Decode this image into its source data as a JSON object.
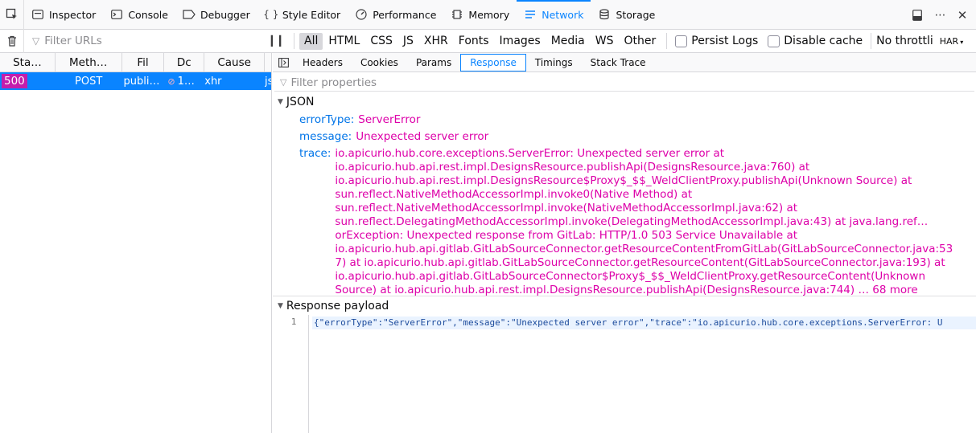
{
  "toolbar": {
    "tabs": [
      {
        "label": "Inspector",
        "icon": "inspector-icon"
      },
      {
        "label": "Console",
        "icon": "console-icon"
      },
      {
        "label": "Debugger",
        "icon": "debugger-icon"
      },
      {
        "label": "Style Editor",
        "icon": "braces-icon"
      },
      {
        "label": "Performance",
        "icon": "performance-icon"
      },
      {
        "label": "Memory",
        "icon": "memory-icon"
      },
      {
        "label": "Network",
        "icon": "network-icon",
        "active": true
      },
      {
        "label": "Storage",
        "icon": "storage-icon"
      }
    ]
  },
  "filterbar": {
    "placeholder": "Filter URLs",
    "types": [
      "All",
      "HTML",
      "CSS",
      "JS",
      "XHR",
      "Fonts",
      "Images",
      "Media",
      "WS",
      "Other"
    ],
    "active_type": "All",
    "persist_logs": "Persist Logs",
    "disable_cache": "Disable cache",
    "throttling": "No throttli",
    "har": "HAR"
  },
  "request_list": {
    "columns": [
      "Sta…",
      "Meth…",
      "Fil",
      "Dc",
      "Cause",
      ""
    ],
    "rows": [
      {
        "status": "500",
        "method": "POST",
        "file": "publi…",
        "domain": "1…",
        "cause": "xhr",
        "type": "js"
      }
    ]
  },
  "details": {
    "tabs": [
      "Headers",
      "Cookies",
      "Params",
      "Response",
      "Timings",
      "Stack Trace"
    ],
    "active_tab": "Response",
    "filter_placeholder": "Filter properties",
    "json_section": "JSON",
    "fields": {
      "errorType_key": "errorType:",
      "errorType_val": "ServerError",
      "message_key": "message:",
      "message_val": "Unexpected server error",
      "trace_key": "trace:"
    },
    "trace_lines": [
      "io.apicurio.hub.core.exceptions.ServerError: Unexpected server error at",
      "io.apicurio.hub.api.rest.impl.DesignsResource.publishApi(DesignsResource.java:760) at",
      "io.apicurio.hub.api.rest.impl.DesignsResource$Proxy$_$$_WeldClientProxy.publishApi(Unknown Source) at",
      "sun.reflect.NativeMethodAccessorImpl.invoke0(Native Method) at",
      "sun.reflect.NativeMethodAccessorImpl.invoke(NativeMethodAccessorImpl.java:62) at",
      "sun.reflect.DelegatingMethodAccessorImpl.invoke(DelegatingMethodAccessorImpl.java:43) at java.lang.ref…",
      "orException: Unexpected response from GitLab: HTTP/1.0 503 Service Unavailable at",
      "io.apicurio.hub.api.gitlab.GitLabSourceConnector.getResourceContentFromGitLab(GitLabSourceConnector.java:53",
      "7) at io.apicurio.hub.api.gitlab.GitLabSourceConnector.getResourceContent(GitLabSourceConnector.java:193) at",
      "io.apicurio.hub.api.gitlab.GitLabSourceConnector$Proxy$_$$_WeldClientProxy.getResourceContent(Unknown",
      "Source) at io.apicurio.hub.api.rest.impl.DesignsResource.publishApi(DesignsResource.java:744) … 68 more"
    ],
    "payload_section": "Response payload",
    "payload_line_number": "1",
    "payload_text": "{\"errorType\":\"ServerError\",\"message\":\"Unexpected server error\",\"trace\":\"io.apicurio.hub.core.exceptions.ServerError: U"
  },
  "colors": {
    "accent": "#0a84ff",
    "status_error": "#c41dac",
    "json_key": "#0074e8",
    "json_value": "#dd00a9"
  }
}
